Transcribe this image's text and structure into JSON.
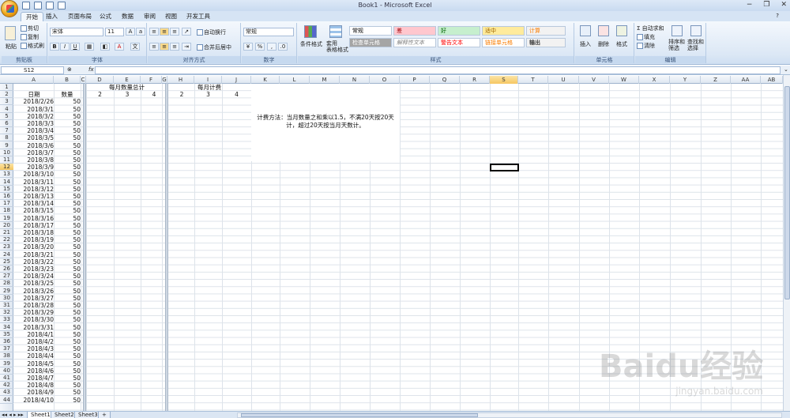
{
  "window": {
    "title": "Book1 - Microsoft Excel"
  },
  "tabs": [
    "开始",
    "插入",
    "页面布局",
    "公式",
    "数据",
    "审阅",
    "视图",
    "开发工具"
  ],
  "ribbon": {
    "clipboard": {
      "paste": "粘贴",
      "cut": "剪切",
      "copy": "复制",
      "format_painter": "格式刷",
      "label": "剪贴板"
    },
    "font": {
      "name": "宋体",
      "size": "11",
      "label": "字体"
    },
    "alignment": {
      "wrap": "自动换行",
      "merge": "合并后居中",
      "label": "对齐方式"
    },
    "number": {
      "format": "常规",
      "label": "数字"
    },
    "styles": {
      "conditional": "条件格式",
      "table": "套用\n表格格式",
      "label": "样式",
      "cells": [
        {
          "text": "常规",
          "bg": "#ffffff",
          "fg": "#000000"
        },
        {
          "text": "差",
          "bg": "#ffc7ce",
          "fg": "#9c0006"
        },
        {
          "text": "好",
          "bg": "#c6efce",
          "fg": "#006100"
        },
        {
          "text": "适中",
          "bg": "#ffeb9c",
          "fg": "#9c6500"
        },
        {
          "text": "计算",
          "bg": "#f2f2f2",
          "fg": "#fa7d00"
        },
        {
          "text": "检查单元格",
          "bg": "#a5a5a5",
          "fg": "#ffffff"
        },
        {
          "text": "解释性文本",
          "bg": "#ffffff",
          "fg": "#7f7f7f"
        },
        {
          "text": "警告文本",
          "bg": "#ffffff",
          "fg": "#ff0000"
        },
        {
          "text": "链接单元格",
          "bg": "#ffffff",
          "fg": "#fa7d00"
        },
        {
          "text": "输出",
          "bg": "#f2f2f2",
          "fg": "#3f3f3f"
        }
      ]
    },
    "cells": {
      "insert": "插入",
      "delete": "删除",
      "format": "格式",
      "label": "单元格"
    },
    "editing": {
      "autosum": "自动求和",
      "fill": "填充",
      "clear": "清除",
      "sort": "排序和\n筛选",
      "find": "查找和\n选择",
      "label": "编辑"
    }
  },
  "formula_bar": {
    "name_box": "S12",
    "fx": "fx"
  },
  "columns": [
    "A",
    "B",
    "C",
    "D",
    "E",
    "F",
    "G",
    "H",
    "I",
    "J",
    "K",
    "L",
    "M",
    "N",
    "O",
    "P",
    "Q",
    "R",
    "S",
    "T",
    "U",
    "V",
    "W",
    "X",
    "Y",
    "Z",
    "AA",
    "AB"
  ],
  "selected_column": "S",
  "selected_row": 12,
  "rows": [
    "1",
    "2",
    "3",
    "4",
    "5",
    "6",
    "7",
    "8",
    "9",
    "10",
    "11",
    "12",
    "13",
    "14",
    "15",
    "16",
    "17",
    "18",
    "19",
    "20",
    "21",
    "22",
    "23",
    "24",
    "25",
    "26",
    "27",
    "28",
    "29",
    "30",
    "31",
    "32",
    "33",
    "34",
    "35",
    "36",
    "37",
    "38",
    "39",
    "40",
    "41",
    "42",
    "43",
    "44"
  ],
  "sheet": {
    "headers": {
      "date": "日期",
      "qty": "数量",
      "monthly_total": "每月数量总计",
      "monthly_fee": "每月计费"
    },
    "monthly_total_values": [
      "2",
      "3",
      "4"
    ],
    "monthly_fee_values": [
      "2",
      "3",
      "4"
    ],
    "dates": [
      "2018/2/26",
      "2018/3/1",
      "2018/3/2",
      "2018/3/3",
      "2018/3/4",
      "2018/3/5",
      "2018/3/6",
      "2018/3/7",
      "2018/3/8",
      "2018/3/9",
      "2018/3/10",
      "2018/3/11",
      "2018/3/12",
      "2018/3/13",
      "2018/3/14",
      "2018/3/15",
      "2018/3/16",
      "2018/3/17",
      "2018/3/18",
      "2018/3/19",
      "2018/3/20",
      "2018/3/21",
      "2018/3/22",
      "2018/3/23",
      "2018/3/24",
      "2018/3/25",
      "2018/3/26",
      "2018/3/27",
      "2018/3/28",
      "2018/3/29",
      "2018/3/30",
      "2018/3/31",
      "2018/4/1",
      "2018/4/2",
      "2018/4/3",
      "2018/4/4",
      "2018/4/5",
      "2018/4/6",
      "2018/4/7",
      "2018/4/8",
      "2018/4/9",
      "2018/4/10"
    ],
    "qty_value": "50",
    "note": "计费方法：当月数量之和乘以1.5，不满20天按20天计，超过20天按当月天数计。"
  },
  "sheet_tabs": [
    "Sheet1",
    "Sheet2",
    "Sheet3"
  ],
  "watermark": {
    "brand": "Baidu经验",
    "url": "jingyan.baidu.com"
  }
}
